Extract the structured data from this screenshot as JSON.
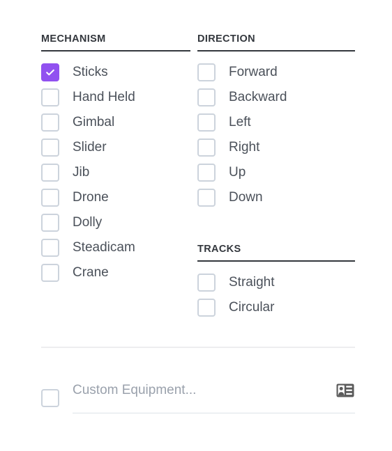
{
  "theme": {
    "accent": "#9151f0",
    "header_text": "#33373d",
    "label_text": "#4b515a",
    "placeholder_text": "#9aa1ac",
    "checkbox_border": "#ccd3dc",
    "divider": "#ededef",
    "input_underline": "#dde2e8",
    "icon": "#5a5a5a",
    "background": "#ffffff"
  },
  "sections": {
    "mechanism": {
      "header": "MECHANISM",
      "items": [
        {
          "label": "Sticks",
          "checked": true
        },
        {
          "label": "Hand Held",
          "checked": false
        },
        {
          "label": "Gimbal",
          "checked": false
        },
        {
          "label": "Slider",
          "checked": false
        },
        {
          "label": "Jib",
          "checked": false
        },
        {
          "label": "Drone",
          "checked": false
        },
        {
          "label": "Dolly",
          "checked": false
        },
        {
          "label": "Steadicam",
          "checked": false
        },
        {
          "label": "Crane",
          "checked": false
        }
      ]
    },
    "direction": {
      "header": "DIRECTION",
      "items": [
        {
          "label": "Forward",
          "checked": false
        },
        {
          "label": "Backward",
          "checked": false
        },
        {
          "label": "Left",
          "checked": false
        },
        {
          "label": "Right",
          "checked": false
        },
        {
          "label": "Up",
          "checked": false
        },
        {
          "label": "Down",
          "checked": false
        }
      ]
    },
    "tracks": {
      "header": "TRACKS",
      "items": [
        {
          "label": "Straight",
          "checked": false
        },
        {
          "label": "Circular",
          "checked": false
        }
      ]
    }
  },
  "custom_equipment": {
    "checked": false,
    "placeholder": "Custom Equipment...",
    "icon": "contact-card-icon"
  }
}
